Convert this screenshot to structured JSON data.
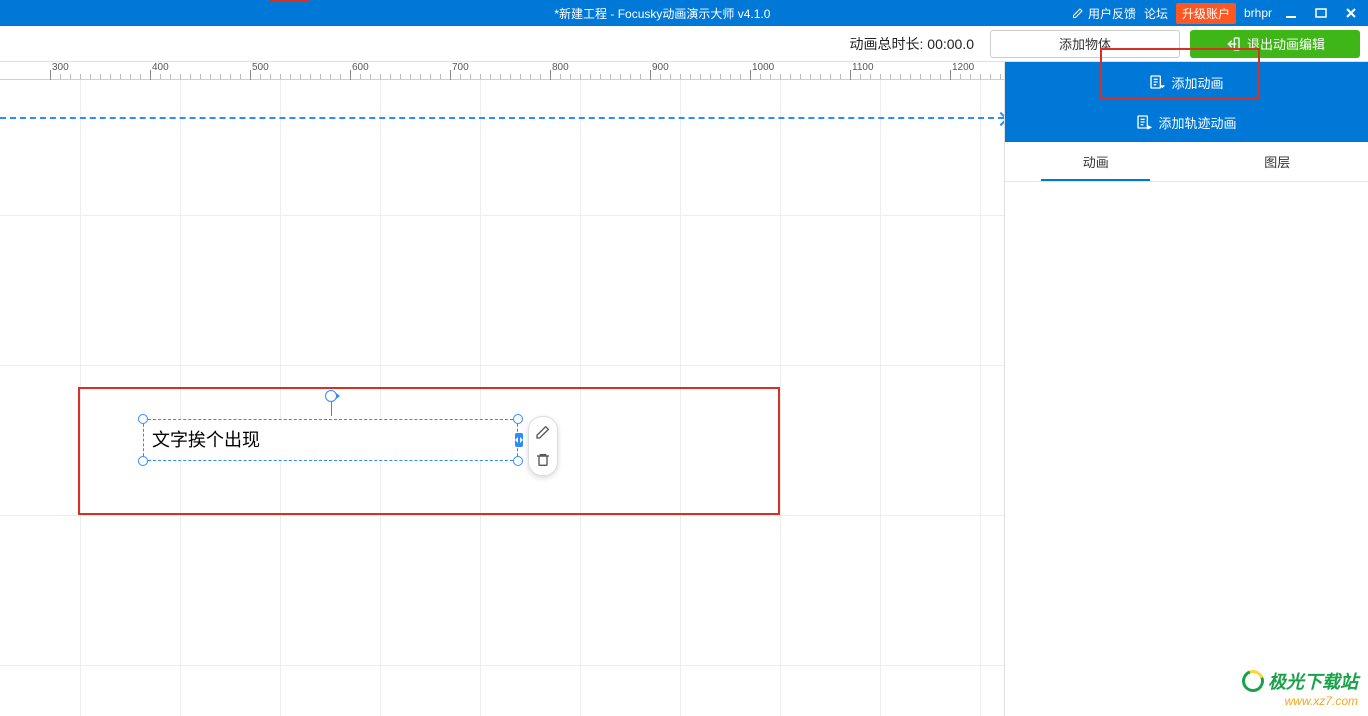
{
  "title": "*新建工程 - Focusky动画演示大师  v4.1.0",
  "titlebar": {
    "feedback": "用户反馈",
    "forum": "论坛",
    "upgrade": "升级账户",
    "username": "brhpr"
  },
  "toolbar": {
    "duration_label": "动画总时长:",
    "duration_value": "00:00.0",
    "add_object": "添加物体",
    "exit_edit": "退出动画编辑"
  },
  "ruler": {
    "ticks": [
      "300",
      "400",
      "500",
      "600",
      "700",
      "800",
      "900",
      "1000",
      "1100",
      "1200"
    ]
  },
  "canvas": {
    "text_content": "文字挨个出现"
  },
  "sidepanel": {
    "add_animation": "添加动画",
    "add_path_animation": "添加轨迹动画",
    "tab_animation": "动画",
    "tab_layer": "图层"
  },
  "watermark": {
    "line1": "极光下载站",
    "line2": "www.xz7.com"
  }
}
